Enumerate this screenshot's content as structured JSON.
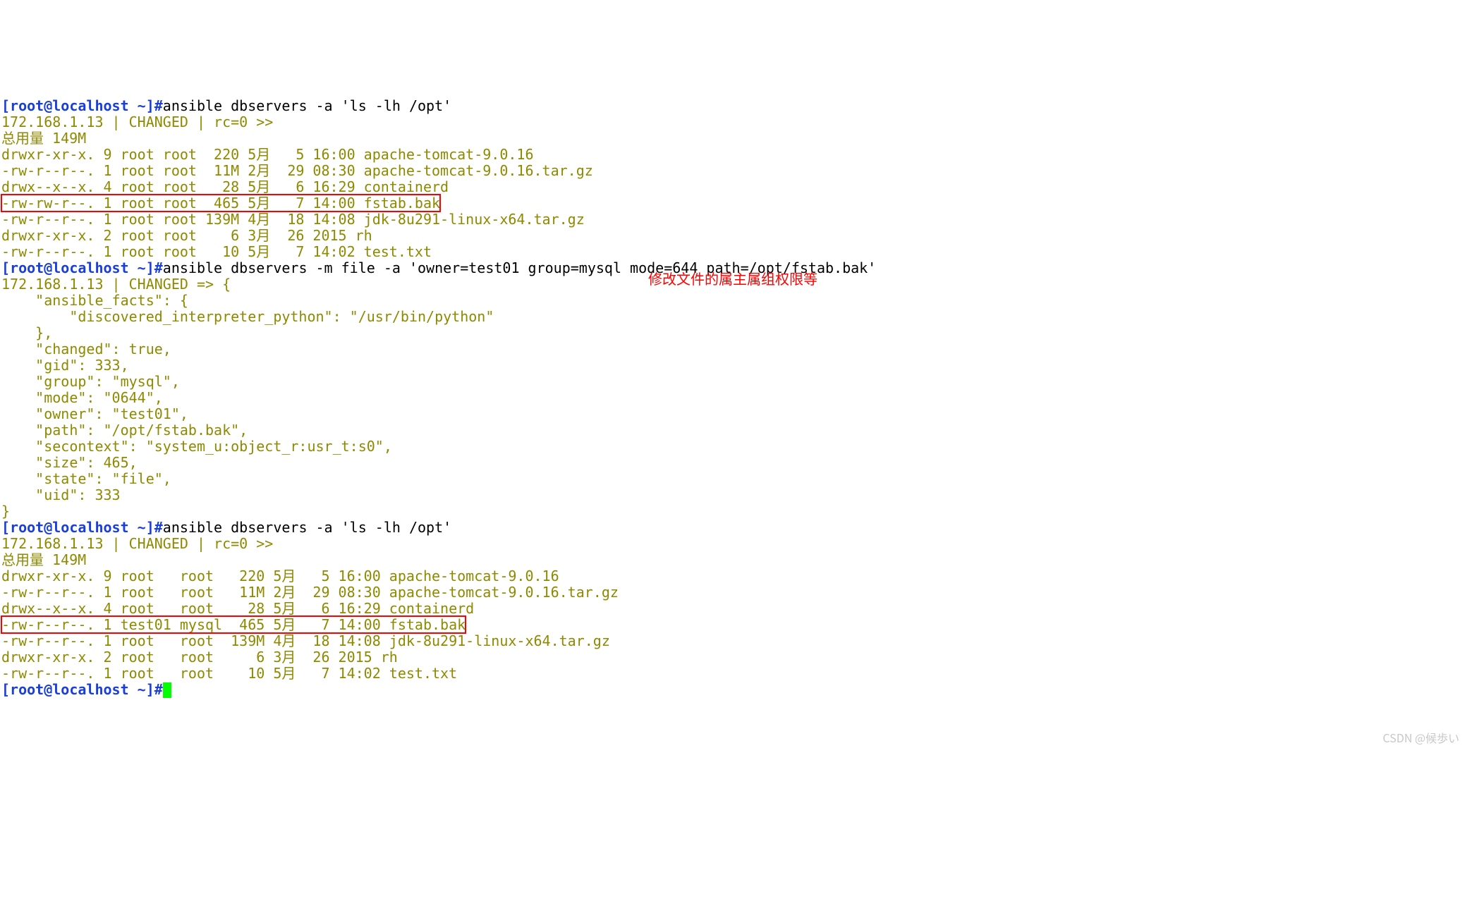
{
  "prompt_user": "[root@localhost ~]#",
  "cmd1": "ansible dbservers -a 'ls -lh /opt'",
  "ls1": {
    "header": "172.168.1.13 | CHANGED | rc=0 >>",
    "total": "总用量 149M",
    "l1": "drwxr-xr-x. 9 root root  220 5月   5 16:00 apache-tomcat-9.0.16",
    "l2": "-rw-r--r--. 1 root root  11M 2月  29 08:30 apache-tomcat-9.0.16.tar.gz",
    "l3": "drwx--x--x. 4 root root   28 5月   6 16:29 containerd",
    "l4": "-rw-rw-r--. 1 root root  465 5月   7 14:00 fstab.bak",
    "l5": "-rw-r--r--. 1 root root 139M 4月  18 14:08 jdk-8u291-linux-x64.tar.gz",
    "l6": "drwxr-xr-x. 2 root root    6 3月  26 2015 rh",
    "l7": "-rw-r--r--. 1 root root   10 5月   7 14:02 test.txt"
  },
  "cmd2": "ansible dbservers -m file -a 'owner=test01 group=mysql mode=644 path=/opt/fstab.bak'",
  "annotation": "修改文件的属主属组权限等",
  "json_out": {
    "l0": "172.168.1.13 | CHANGED => {",
    "l1": "    \"ansible_facts\": {",
    "l2": "        \"discovered_interpreter_python\": \"/usr/bin/python\"",
    "l3": "    },",
    "l4": "    \"changed\": true,",
    "l5": "    \"gid\": 333,",
    "l6": "    \"group\": \"mysql\",",
    "l7": "    \"mode\": \"0644\",",
    "l8": "    \"owner\": \"test01\",",
    "l9": "    \"path\": \"/opt/fstab.bak\",",
    "l10": "    \"secontext\": \"system_u:object_r:usr_t:s0\",",
    "l11": "    \"size\": 465,",
    "l12": "    \"state\": \"file\",",
    "l13": "    \"uid\": 333",
    "l14": "}"
  },
  "cmd3": "ansible dbservers -a 'ls -lh /opt'",
  "ls2": {
    "header": "172.168.1.13 | CHANGED | rc=0 >>",
    "total": "总用量 149M",
    "l1": "drwxr-xr-x. 9 root   root   220 5月   5 16:00 apache-tomcat-9.0.16",
    "l2": "-rw-r--r--. 1 root   root   11M 2月  29 08:30 apache-tomcat-9.0.16.tar.gz",
    "l3": "drwx--x--x. 4 root   root    28 5月   6 16:29 containerd",
    "l4": "-rw-r--r--. 1 test01 mysql  465 5月   7 14:00 fstab.bak",
    "l5": "-rw-r--r--. 1 root   root  139M 4月  18 14:08 jdk-8u291-linux-x64.tar.gz",
    "l6": "drwxr-xr-x. 2 root   root     6 3月  26 2015 rh",
    "l7": "-rw-r--r--. 1 root   root    10 5月   7 14:02 test.txt"
  },
  "watermark": "CSDN @候歩い"
}
